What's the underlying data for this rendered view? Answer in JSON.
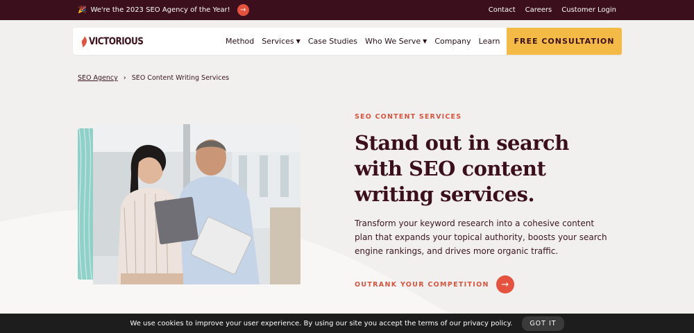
{
  "topbar": {
    "announcement": "We're the 2023 SEO Agency of the Year!",
    "announcement_icon": "party-popper-icon",
    "links": [
      "Contact",
      "Careers",
      "Customer Login"
    ]
  },
  "nav": {
    "logo_text": "VICTORIOUS",
    "items": [
      {
        "label": "Method",
        "dropdown": false
      },
      {
        "label": "Services",
        "dropdown": true
      },
      {
        "label": "Case Studies",
        "dropdown": false
      },
      {
        "label": "Who We Serve",
        "dropdown": true
      },
      {
        "label": "Company",
        "dropdown": false
      },
      {
        "label": "Learn",
        "dropdown": false
      }
    ],
    "cta_label": "FREE CONSULTATION"
  },
  "breadcrumb": {
    "parent": "SEO Agency",
    "current": "SEO Content Writing Services"
  },
  "hero": {
    "eyebrow": "SEO CONTENT SERVICES",
    "headline": "Stand out in search with SEO content writing services.",
    "body": "Transform your keyword research into a cohesive content plan that expands your topical authority, boosts your search engine rankings, and drives more organic traffic.",
    "cta_label": "OUTRANK YOUR COMPETITION"
  },
  "cookie": {
    "message": "We use cookies to improve your user experience. By using our site you accept the terms of our privacy policy.",
    "button": "GOT IT"
  },
  "colors": {
    "topbar_bg": "#3b0f1c",
    "accent": "#e5533f",
    "cta_yellow": "#f3bb45",
    "teal": "#8fd0c8",
    "page_bg": "#f1f0ef"
  }
}
